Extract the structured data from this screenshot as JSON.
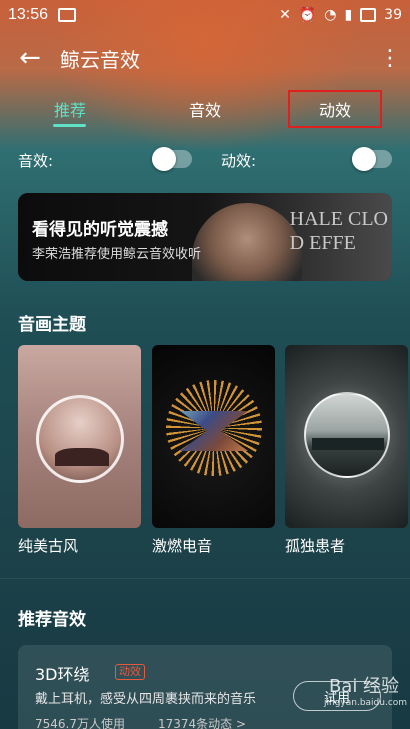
{
  "status_bar": {
    "time": "13:56",
    "battery": "39"
  },
  "appbar": {
    "title": "鲸云音效",
    "back_icon": "arrow-left-icon",
    "more_icon": "more-vert-icon"
  },
  "tabs": [
    {
      "label": "推荐",
      "active": true
    },
    {
      "label": "音效",
      "active": false
    },
    {
      "label": "动效",
      "active": false,
      "highlighted": true
    }
  ],
  "switches": {
    "sound_label": "音效:",
    "motion_label": "动效:",
    "sound_on": false,
    "motion_on": false
  },
  "banner": {
    "title": "看得见的听觉震撼",
    "subtitle": "李荣浩推荐使用鲸云音效收听",
    "bg_text_line1": "HALE CLO",
    "bg_text_line2": "D EFFE"
  },
  "themes": {
    "section_title": "音画主题",
    "items": [
      {
        "label": "纯美古风"
      },
      {
        "label": "激燃电音"
      },
      {
        "label": "孤独患者"
      }
    ]
  },
  "recommend": {
    "section_title": "推荐音效",
    "card": {
      "name": "3D环绕",
      "badge": "动效",
      "desc": "戴上耳机，感受从四周裹挟而来的音乐",
      "users": "7546.7万人使用",
      "count": "17374条动态 >",
      "try_label": "试用"
    }
  },
  "watermark": {
    "brand": "Bai 经验",
    "site": "jingyan.baidu.com"
  },
  "colors": {
    "accent": "#5fe0c7",
    "highlight_box": "#e0201f",
    "badge": "#e85a3c"
  }
}
